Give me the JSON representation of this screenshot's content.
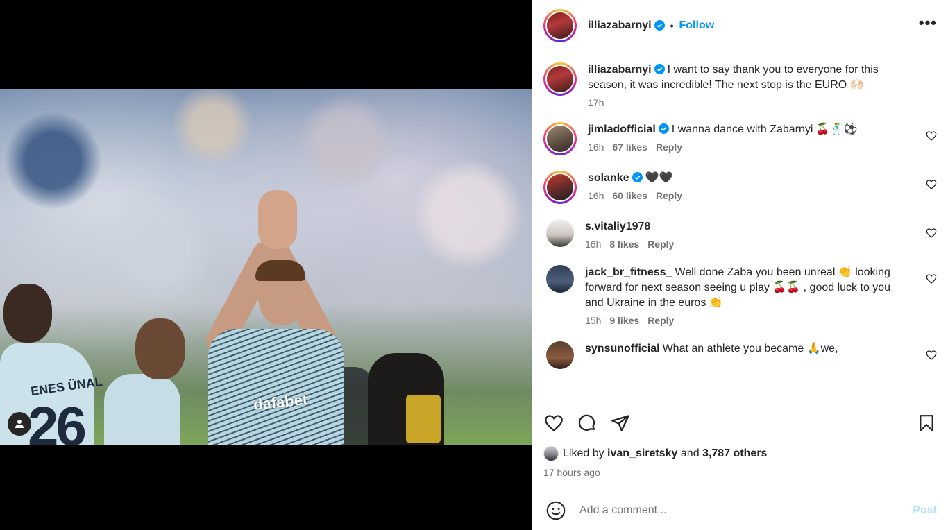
{
  "post": {
    "author": "illiazabarnyi",
    "follow_label": "Follow",
    "dot": "•",
    "more_label": "•••"
  },
  "caption": {
    "username": "illiazabarnyi",
    "text": "I want to say thank you to everyone for this season, it was incredible! The next stop is the EURO 🙌🏻",
    "time": "17h"
  },
  "comments": [
    {
      "username": "jimladofficial",
      "verified": true,
      "text": "I wanna dance with Zabarnyi 🍒🕺⚽",
      "time": "16h",
      "likes": "67 likes",
      "reply": "Reply"
    },
    {
      "username": "solanke",
      "verified": true,
      "text": "🖤🖤",
      "time": "16h",
      "likes": "60 likes",
      "reply": "Reply"
    },
    {
      "username": "s.vitaliy1978",
      "verified": false,
      "text": "",
      "time": "16h",
      "likes": "8 likes",
      "reply": "Reply"
    },
    {
      "username": "jack_br_fitness_",
      "verified": false,
      "text": "Well done Zaba you been unreal 👏 looking forward for next season seeing u play 🍒🍒 , good luck to you and Ukraine in the euros 👏",
      "time": "15h",
      "likes": "9 likes",
      "reply": "Reply"
    },
    {
      "username": "synsunofficial",
      "verified": false,
      "text": "What an athlete you became 🙏we,",
      "time": "",
      "likes": "",
      "reply": ""
    }
  ],
  "photo": {
    "jersey_name": "ENES ÜNAL",
    "jersey_number": "26",
    "sponsor": "dafabet"
  },
  "liked_by": {
    "prefix": "Liked by",
    "user": "ivan_siretsky",
    "and": "and",
    "others": "3,787 others"
  },
  "posted_time": "17 hours ago",
  "add_comment": {
    "placeholder": "Add a comment...",
    "post_label": "Post"
  },
  "colors": {
    "accent": "#0095f6",
    "verified": "#0095f6",
    "muted": "#737373"
  }
}
